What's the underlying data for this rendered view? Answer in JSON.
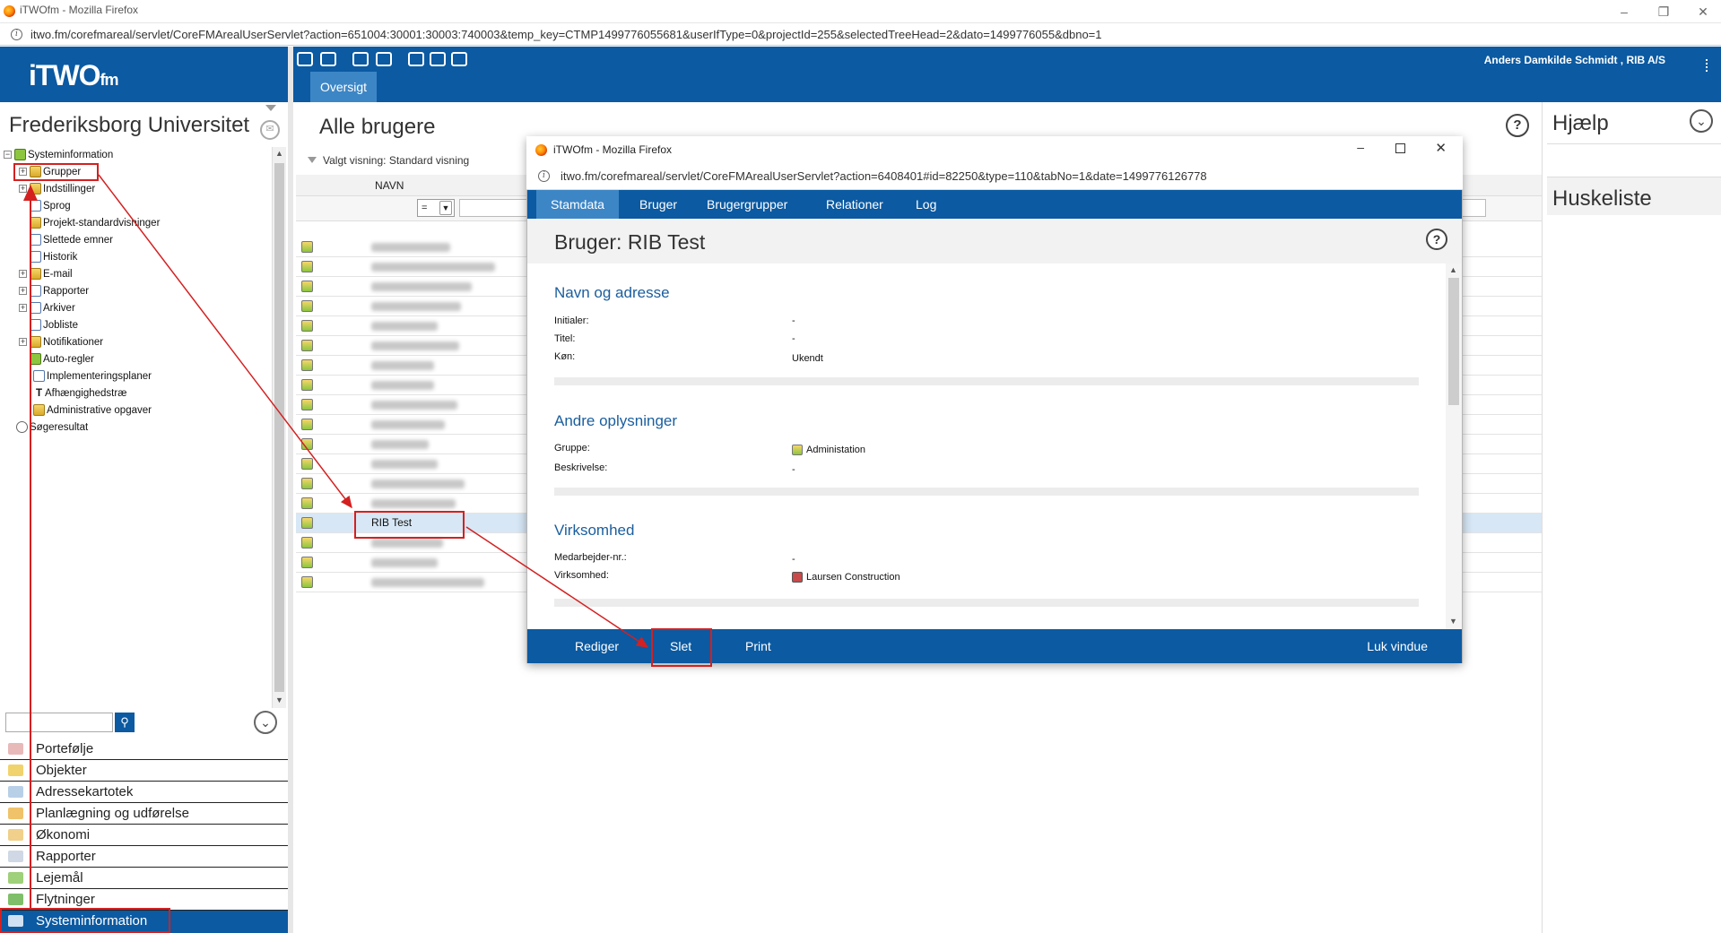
{
  "browser": {
    "window_title": "iTWOfm - Mozilla Firefox",
    "url": "itwo.fm/corefmareal/servlet/CoreFMArealUserServlet?action=651004:30001:30003:740003&temp_key=CTMP1499776055681&userIfType=0&projectId=255&selectedTreeHead=2&dato=1499776055&dbno=1"
  },
  "app": {
    "logo_main": "iTWO",
    "logo_suffix": "fm",
    "user": "Anders Damkilde Schmidt , RIB A/S",
    "org_title": "Frederiksborg Universitet"
  },
  "tabs": {
    "oversigt": "Oversigt"
  },
  "tree": [
    {
      "label": "Systeminformation"
    },
    {
      "label": "Grupper"
    },
    {
      "label": "Indstillinger"
    },
    {
      "label": "Sprog"
    },
    {
      "label": "Projekt-standardvisninger"
    },
    {
      "label": "Slettede emner"
    },
    {
      "label": "Historik"
    },
    {
      "label": "E-mail"
    },
    {
      "label": "Rapporter"
    },
    {
      "label": "Arkiver"
    },
    {
      "label": "Jobliste"
    },
    {
      "label": "Notifikationer"
    },
    {
      "label": "Auto-regler"
    },
    {
      "label": "Implementeringsplaner"
    },
    {
      "label": "Afhængighedstræ"
    },
    {
      "label": "Administrative opgaver"
    },
    {
      "label": "Søgeresultat"
    }
  ],
  "modules": [
    {
      "label": "Portefølje"
    },
    {
      "label": "Objekter"
    },
    {
      "label": "Adressekartotek"
    },
    {
      "label": "Planlægning og udførelse"
    },
    {
      "label": "Økonomi"
    },
    {
      "label": "Rapporter"
    },
    {
      "label": "Lejemål"
    },
    {
      "label": "Flytninger"
    },
    {
      "label": "Systeminformation"
    }
  ],
  "main": {
    "title": "Alle brugere",
    "view_label": "Valgt visning: Standard visning",
    "column_navn": "NAVN",
    "filter_operator": "=",
    "selected_user": "RIB Test"
  },
  "right": {
    "help": "Hjælp",
    "memo": "Huskeliste"
  },
  "popup": {
    "window_title": "iTWOfm - Mozilla Firefox",
    "url": "itwo.fm/corefmareal/servlet/CoreFMArealUserServlet?action=6408401#id=82250&type=110&tabNo=1&date=1499776126778",
    "tabs": [
      "Stamdata",
      "Bruger",
      "Brugergrupper",
      "Relationer",
      "Log"
    ],
    "heading": "Bruger: RIB Test",
    "sections": {
      "navn": {
        "title": "Navn og adresse",
        "initialer_label": "Initialer:",
        "initialer_value": "-",
        "titel_label": "Titel:",
        "titel_value": "-",
        "koen_label": "Køn:",
        "koen_value": "Ukendt"
      },
      "andre": {
        "title": "Andre oplysninger",
        "gruppe_label": "Gruppe:",
        "gruppe_value": "Administation",
        "beskrivelse_label": "Beskrivelse:",
        "beskrivelse_value": "-"
      },
      "virksomhed": {
        "title": "Virksomhed",
        "medarbejder_label": "Medarbejder-nr.:",
        "medarbejder_value": "-",
        "virksomhed_label": "Virksomhed:",
        "virksomhed_value": "Laursen Construction"
      }
    },
    "footer": {
      "rediger": "Rediger",
      "slet": "Slet",
      "print": "Print",
      "luk": "Luk vindue"
    }
  },
  "colors": {
    "brand_blue": "#0b5aa2",
    "tab_active": "#3d86c6",
    "annotation_red": "#d42020"
  }
}
